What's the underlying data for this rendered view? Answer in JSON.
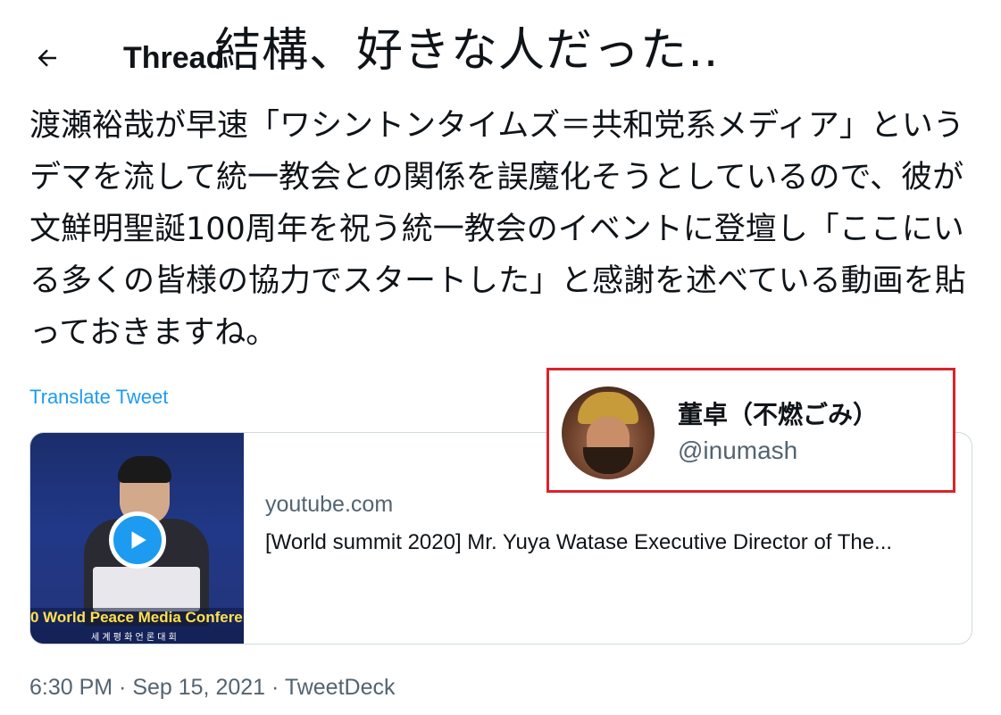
{
  "overlay_caption": "結構、好きな人だった‥",
  "header": {
    "back_icon": "arrow-left-icon",
    "title": "Thread"
  },
  "tweet": {
    "text": "渡瀬裕哉が早速「ワシントンタイムズ＝共和党系メディア」というデマを流して統一教会との関係を誤魔化そうとしているので、彼が文鮮明聖誕100周年を祝う統一教会のイベントに登壇し「ここにいる多くの皆様の協力でスタートした」と感謝を述べている動画を貼っておきますね。",
    "translate_label": "Translate Tweet",
    "timestamp": "6:30 PM · Sep 15, 2021 · TweetDeck"
  },
  "card": {
    "domain": "youtube.com",
    "title": "[World summit 2020] Mr. Yuya Watase Executive Director of The...",
    "thumbnail_banner": "0 World Peace Media Conferen",
    "thumbnail_subtitle": "세 계 평 화 언 론 대 회",
    "play_icon": "play-icon"
  },
  "user": {
    "display_name": "董卓（不燃ごみ）",
    "handle": "@inumash",
    "highlight_color": "#d9242a"
  },
  "colors": {
    "link": "#1d9bf0",
    "secondary_text": "#536471",
    "primary_text": "#0f1419",
    "border": "#cfd9de"
  }
}
